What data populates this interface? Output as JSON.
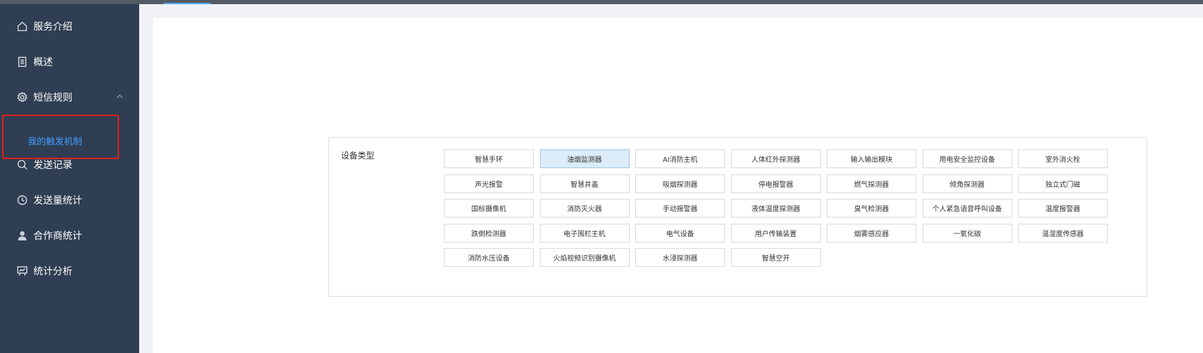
{
  "sidebar": {
    "items": [
      {
        "label": "服务介绍",
        "icon": "home-icon"
      },
      {
        "label": "概述",
        "icon": "document-icon"
      },
      {
        "label": "短信规则",
        "icon": "gear-icon"
      },
      {
        "label": "发送记录",
        "icon": "search-icon"
      },
      {
        "label": "发送量统计",
        "icon": "clock-icon"
      },
      {
        "label": "合作商统计",
        "icon": "user-icon"
      },
      {
        "label": "统计分析",
        "icon": "presentation-chart-icon"
      }
    ],
    "sub_item": {
      "label": "我的触发机制"
    }
  },
  "panel": {
    "label": "设备类型",
    "selected": "油烟监测器",
    "devices": [
      "智慧手环",
      "油烟监测器",
      "AI消防主机",
      "人体红外探测器",
      "输入输出模块",
      "用电安全监控设备",
      "室外消火栓",
      "声光报警",
      "智慧井盖",
      "吸烟探测器",
      "停电报警器",
      "燃气探测器",
      "倾角探测器",
      "独立式门磁",
      "国标摄像机",
      "消防灭火器",
      "手动报警器",
      "液体温度探测器",
      "臭气检测器",
      "个人紧急语音呼叫设备",
      "温度报警器",
      "跌倒检测器",
      "电子围栏主机",
      "电气设备",
      "用户传输装置",
      "烟雾感应器",
      "一氧化碳",
      "温湿度传感器",
      "消防水压设备",
      "火焰视频识别摄像机",
      "水浸探测器",
      "智慧空开"
    ]
  },
  "colors": {
    "sidebar_bg": "#2f3e52",
    "active_link": "#409eff",
    "highlight_border": "#e0211f",
    "selected_btn_bg": "#dcecf8"
  }
}
